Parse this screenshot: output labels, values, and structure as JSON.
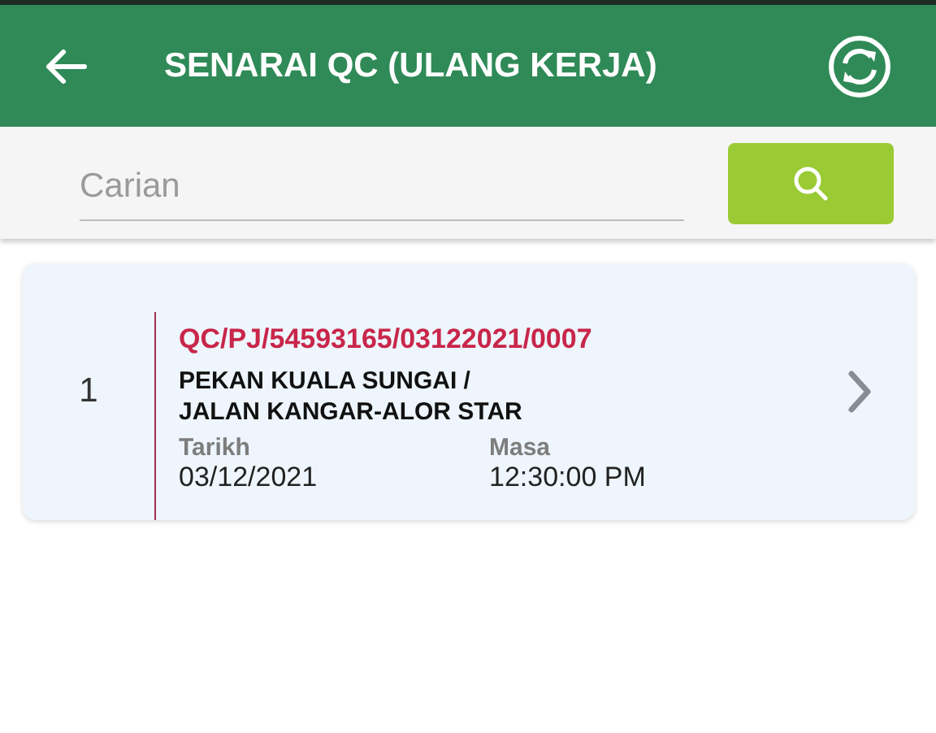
{
  "app_bar": {
    "title": "SENARAI QC (ULANG KERJA)"
  },
  "search": {
    "placeholder": "Carian"
  },
  "records": [
    {
      "number": "1",
      "reference": "QC/PJ/54593165/03122021/0007",
      "location_lines": [
        "PEKAN KUALA SUNGAI /",
        "JALAN KANGAR-ALOR STAR"
      ],
      "fields": [
        {
          "label": "Tarikh",
          "value": "03/12/2021"
        },
        {
          "label": "Masa",
          "value": "12:30:00 PM"
        }
      ]
    }
  ]
}
